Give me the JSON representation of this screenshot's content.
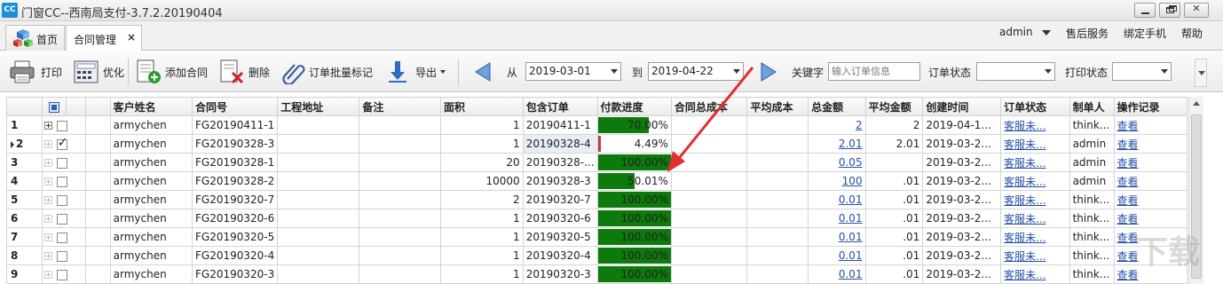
{
  "window": {
    "title": "门窗CC--西南局支付-3.7.2.20190404",
    "logo": "CC"
  },
  "tabs": [
    {
      "label": "首页"
    },
    {
      "label": "合同管理",
      "close": "×"
    }
  ],
  "top_menu": {
    "admin": "admin",
    "after_sales": "售后服务",
    "bind_phone": "绑定手机",
    "help": "帮助"
  },
  "toolbar": {
    "print": "打印",
    "optimize": "优化",
    "add_contract": "添加合同",
    "delete": "删除",
    "batch_mark": "订单批量标记",
    "export": "导出",
    "from_label": "从",
    "from_date": "2019-03-01",
    "to_label": "到",
    "to_date": "2019-04-22",
    "keyword_label": "关键字",
    "keyword_placeholder": "输入订单信息",
    "order_status_label": "订单状态",
    "print_status_label": "打印状态"
  },
  "grid": {
    "columns": [
      "客户姓名",
      "合同号",
      "工程地址",
      "备注",
      "面积",
      "包含订单",
      "付款进度",
      "合同总成本",
      "平均成本",
      "总金额",
      "平均金额",
      "创建时间",
      "订单状态",
      "制单人",
      "操作记录"
    ],
    "rows": [
      {
        "n": "1",
        "customer": "armychen",
        "contract": "FG20190411-1",
        "address": "",
        "note": "",
        "area": "1",
        "orders": "20190411-1",
        "progress": 0.7,
        "progress_text": "70.00%",
        "total_cost": "",
        "avg_cost": "",
        "total_amount": "2",
        "avg_amount": "2",
        "created": "2019-04-1...",
        "status": "客服未...",
        "maker": "think...",
        "log": "查看"
      },
      {
        "n": "2",
        "customer": "armychen",
        "contract": "FG20190328-3",
        "address": "",
        "note": "",
        "area": "1",
        "orders": "20190328-4",
        "progress": 0.0449,
        "progress_text": "4.49%",
        "total_cost": "",
        "avg_cost": "",
        "total_amount": "2.01",
        "avg_amount": "2.01",
        "created": "2019-03-2...",
        "status": "客服未...",
        "maker": "admin",
        "log": "查看"
      },
      {
        "n": "3",
        "customer": "armychen",
        "contract": "FG20190328-1",
        "address": "",
        "note": "",
        "area": "20",
        "orders": "20190328-...",
        "progress": 1.0,
        "progress_text": "100.00%",
        "total_cost": "",
        "avg_cost": "",
        "total_amount": "0.05",
        "avg_amount": "",
        "created": "2019-03-2...",
        "status": "客服未...",
        "maker": "admin",
        "log": "查看"
      },
      {
        "n": "4",
        "customer": "armychen",
        "contract": "FG20190328-2",
        "address": "",
        "note": "",
        "area": "10000",
        "orders": "20190328-3",
        "progress": 0.5001,
        "progress_text": "50.01%",
        "total_cost": "",
        "avg_cost": "",
        "total_amount": "100",
        "avg_amount": ".01",
        "created": "2019-03-2...",
        "status": "客服未...",
        "maker": "admin",
        "log": "查看"
      },
      {
        "n": "5",
        "customer": "armychen",
        "contract": "FG20190320-7",
        "address": "",
        "note": "",
        "area": "2",
        "orders": "20190320-7",
        "progress": 1.0,
        "progress_text": "100.00%",
        "total_cost": "",
        "avg_cost": "",
        "total_amount": "0.01",
        "avg_amount": ".01",
        "created": "2019-03-2...",
        "status": "客服未...",
        "maker": "think...",
        "log": "查看"
      },
      {
        "n": "6",
        "customer": "armychen",
        "contract": "FG20190320-6",
        "address": "",
        "note": "",
        "area": "1",
        "orders": "20190320-6",
        "progress": 1.0,
        "progress_text": "100.00%",
        "total_cost": "",
        "avg_cost": "",
        "total_amount": "0.01",
        "avg_amount": ".01",
        "created": "2019-03-2...",
        "status": "客服未...",
        "maker": "think...",
        "log": "查看"
      },
      {
        "n": "7",
        "customer": "armychen",
        "contract": "FG20190320-5",
        "address": "",
        "note": "",
        "area": "1",
        "orders": "20190320-5",
        "progress": 1.0,
        "progress_text": "100.00%",
        "total_cost": "",
        "avg_cost": "",
        "total_amount": "0.01",
        "avg_amount": ".01",
        "created": "2019-03-2...",
        "status": "客服未...",
        "maker": "think...",
        "log": "查看"
      },
      {
        "n": "8",
        "customer": "armychen",
        "contract": "FG20190320-4",
        "address": "",
        "note": "",
        "area": "1",
        "orders": "20190320-4",
        "progress": 1.0,
        "progress_text": "100.00%",
        "total_cost": "",
        "avg_cost": "",
        "total_amount": "0.01",
        "avg_amount": ".01",
        "created": "2019-03-2...",
        "status": "客服未...",
        "maker": "think...",
        "log": "查看"
      },
      {
        "n": "9",
        "customer": "armychen",
        "contract": "FG20190320-3",
        "address": "",
        "note": "",
        "area": "1",
        "orders": "20190320-3",
        "progress": 1.0,
        "progress_text": "100.00%",
        "total_cost": "",
        "avg_cost": "",
        "total_amount": "0.01",
        "avg_amount": ".01",
        "created": "2019-03-2...",
        "status": "客服未...",
        "maker": "think...",
        "log": "查看"
      }
    ]
  },
  "colors": {
    "progress_fill": "#0d7a0d",
    "link": "#2450a8",
    "annotation": "#e03030"
  },
  "watermark": "下载吧"
}
